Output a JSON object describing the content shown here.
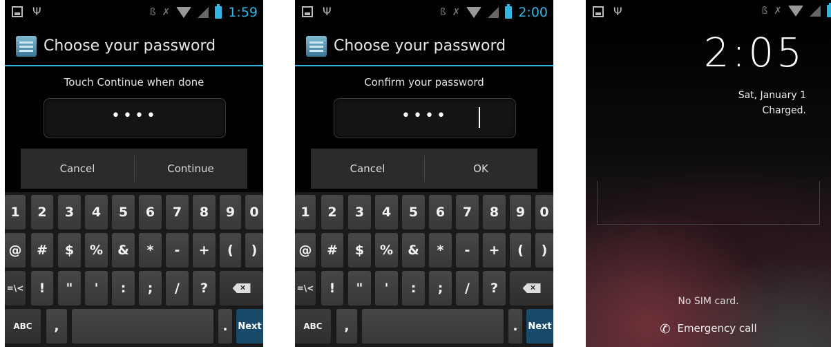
{
  "screens": [
    {
      "status_time": "1:59",
      "title": "Choose your password",
      "prompt": "Touch Continue when done",
      "password_mask": "••••",
      "buttons": {
        "left": "Cancel",
        "right": "Continue"
      }
    },
    {
      "status_time": "2:00",
      "title": "Choose your password",
      "prompt": "Confirm your password",
      "password_mask": "••••",
      "buttons": {
        "left": "Cancel",
        "right": "OK"
      }
    }
  ],
  "keyboard": {
    "row1": [
      "1",
      "2",
      "3",
      "4",
      "5",
      "6",
      "7",
      "8",
      "9",
      "0"
    ],
    "row2": [
      "@",
      "#",
      "$",
      "%",
      "&",
      "*",
      "-",
      "+",
      "(",
      ")"
    ],
    "row3": [
      "=\\<",
      "!",
      "\"",
      "'",
      ":",
      ";",
      "/",
      "?"
    ],
    "row4": {
      "abc": "ABC",
      "comma": ",",
      "period": ".",
      "next": "Next"
    }
  },
  "lockscreen": {
    "clock": "2:05",
    "date": "Sat, January 1",
    "battery": "Charged.",
    "sim_status": "No SIM card.",
    "emergency": "Emergency call"
  },
  "colors": {
    "accent": "#33b5e5",
    "background": "#000000"
  }
}
